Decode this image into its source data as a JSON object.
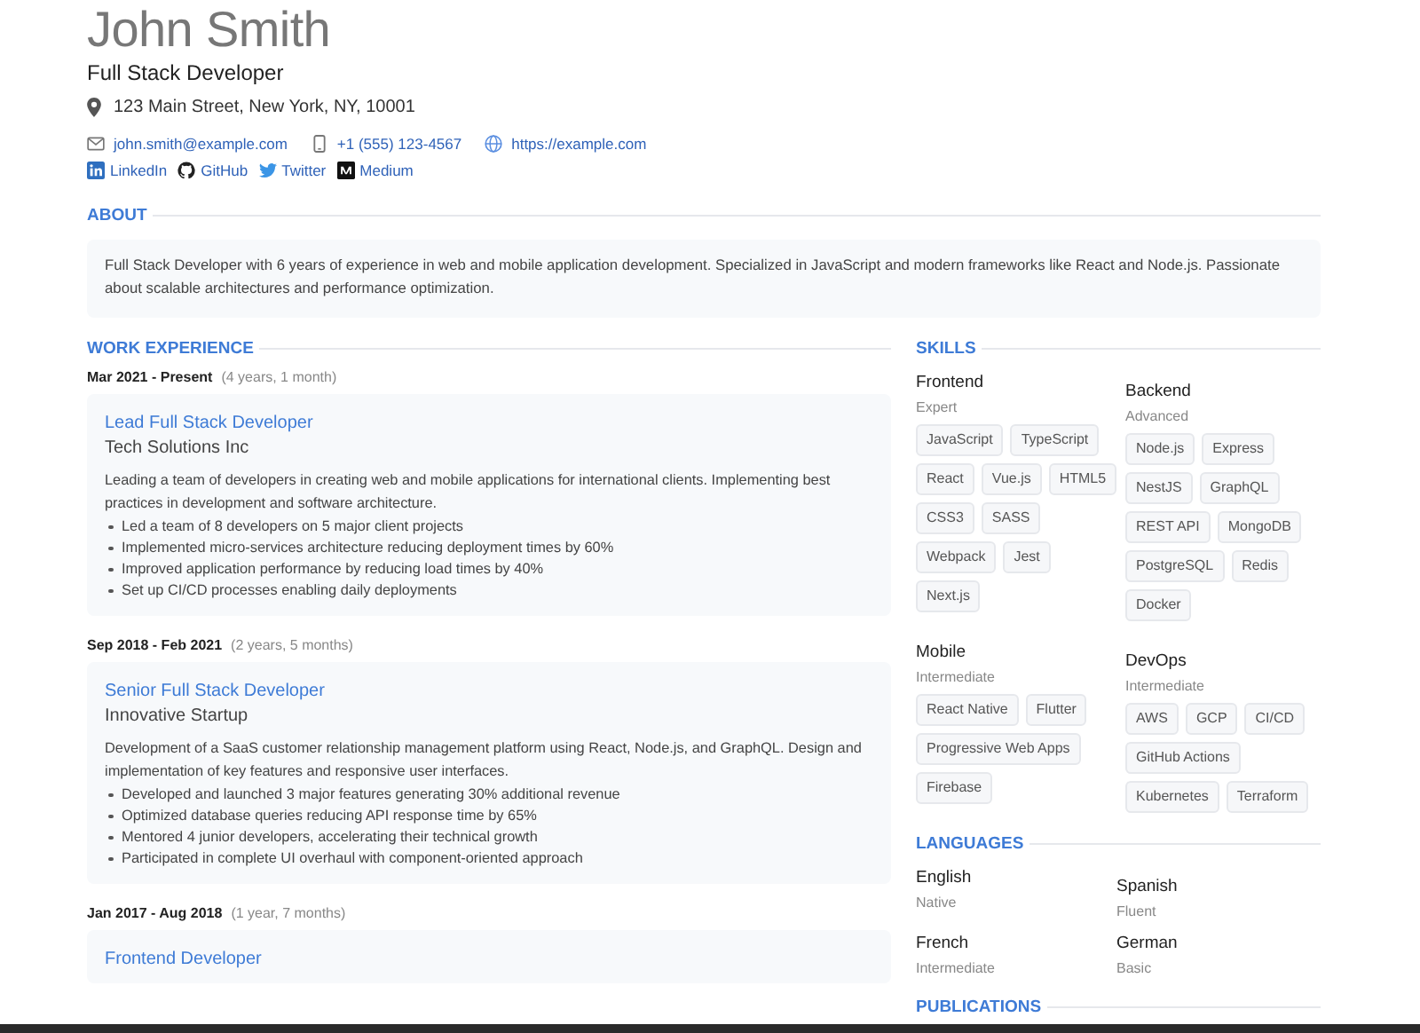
{
  "header": {
    "name": "John Smith",
    "title": "Full Stack Developer",
    "address": "123 Main Street, New York, NY, 10001",
    "contacts": [
      {
        "kind": "email",
        "text": "john.smith@example.com"
      },
      {
        "kind": "phone",
        "text": "+1 (555) 123-4567"
      },
      {
        "kind": "web",
        "text": "https://example.com"
      }
    ],
    "socials": [
      {
        "kind": "linkedin",
        "label": "LinkedIn"
      },
      {
        "kind": "github",
        "label": "GitHub"
      },
      {
        "kind": "twitter",
        "label": "Twitter"
      },
      {
        "kind": "medium",
        "label": "Medium"
      }
    ]
  },
  "about": {
    "heading": "ABOUT",
    "text": "Full Stack Developer with 6 years of experience in web and mobile application development. Specialized in JavaScript and modern frameworks like React and Node.js. Passionate about scalable architectures and performance optimization."
  },
  "experience": {
    "heading": "WORK EXPERIENCE",
    "jobs": [
      {
        "dates": "Mar 2021 - Present",
        "duration": "(4 years, 1 month)",
        "title": "Lead Full Stack Developer",
        "company": "Tech Solutions Inc",
        "description": "Leading a team of developers in creating web and mobile applications for international clients. Implementing best practices in development and software architecture.",
        "bullets": [
          "Led a team of 8 developers on 5 major client projects",
          "Implemented micro-services architecture reducing deployment times by 60%",
          "Improved application performance by reducing load times by 40%",
          "Set up CI/CD processes enabling daily deployments"
        ]
      },
      {
        "dates": "Sep 2018 - Feb 2021",
        "duration": "(2 years, 5 months)",
        "title": "Senior Full Stack Developer",
        "company": "Innovative Startup",
        "description": "Development of a SaaS customer relationship management platform using React, Node.js, and GraphQL. Design and implementation of key features and responsive user interfaces.",
        "bullets": [
          "Developed and launched 3 major features generating 30% additional revenue",
          "Optimized database queries reducing API response time by 65%",
          "Mentored 4 junior developers, accelerating their technical growth",
          "Participated in complete UI overhaul with component-oriented approach"
        ]
      },
      {
        "dates": "Jan 2017 - Aug 2018",
        "duration": "(1 year, 7 months)",
        "title": "Frontend Developer"
      }
    ]
  },
  "skills": {
    "heading": "SKILLS",
    "groups": [
      {
        "name": "Frontend",
        "level": "Expert",
        "tags": [
          "JavaScript",
          "TypeScript",
          "React",
          "Vue.js",
          "HTML5",
          "CSS3",
          "SASS",
          "Webpack",
          "Jest",
          "Next.js"
        ]
      },
      {
        "name": "Backend",
        "level": "Advanced",
        "tags": [
          "Node.js",
          "Express",
          "NestJS",
          "GraphQL",
          "REST API",
          "MongoDB",
          "PostgreSQL",
          "Redis",
          "Docker"
        ]
      },
      {
        "name": "Mobile",
        "level": "Intermediate",
        "tags": [
          "React Native",
          "Flutter",
          "Progressive Web Apps",
          "Firebase"
        ]
      },
      {
        "name": "DevOps",
        "level": "Intermediate",
        "tags": [
          "AWS",
          "GCP",
          "CI/CD",
          "GitHub Actions",
          "Kubernetes",
          "Terraform"
        ]
      }
    ]
  },
  "languages": {
    "heading": "LANGUAGES",
    "items": [
      {
        "name": "English",
        "level": "Native"
      },
      {
        "name": "Spanish",
        "level": "Fluent"
      },
      {
        "name": "French",
        "level": "Intermediate"
      },
      {
        "name": "German",
        "level": "Basic"
      }
    ]
  },
  "publications": {
    "heading": "PUBLICATIONS"
  }
}
